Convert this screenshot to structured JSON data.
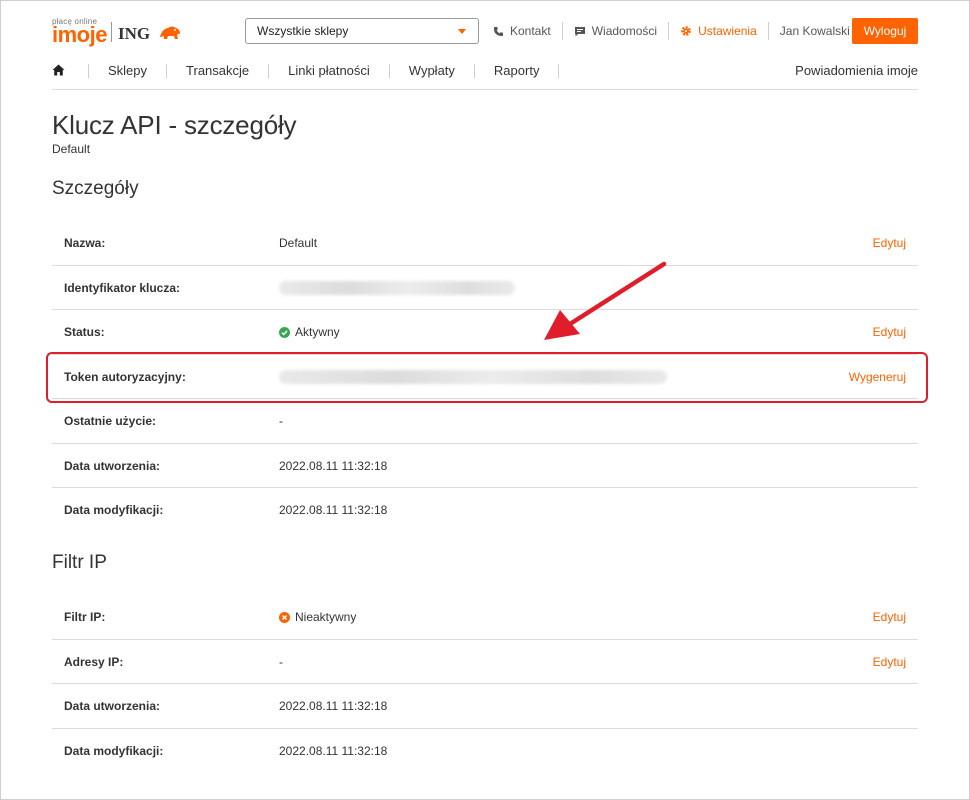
{
  "header": {
    "logo_tagline": "płacę online",
    "logo_brand": "imoje",
    "logo_bank": "ING",
    "shop_select": "Wszystkie sklepy",
    "nav": [
      {
        "label": "Kontakt",
        "icon": "phone-icon"
      },
      {
        "label": "Wiadomości",
        "icon": "message-icon"
      },
      {
        "label": "Ustawienia",
        "icon": "gear-icon"
      },
      {
        "label": "Jan Kowalski",
        "icon": ""
      }
    ],
    "logout_label": "Wyloguj"
  },
  "main_nav": {
    "items": [
      "Sklepy",
      "Transakcje",
      "Linki płatności",
      "Wypłaty",
      "Raporty"
    ],
    "notifications": "Powiadomienia imoje"
  },
  "page": {
    "title": "Klucz API - szczegóły",
    "subtitle": "Default"
  },
  "details": {
    "heading": "Szczegóły",
    "rows": [
      {
        "label": "Nazwa:",
        "value": "Default",
        "action": "Edytuj"
      },
      {
        "label": "Identyfikator klucza:",
        "value": "",
        "action": ""
      },
      {
        "label": "Status:",
        "value": "Aktywny",
        "action": "Edytuj"
      },
      {
        "label": "Token autoryzacyjny:",
        "value": "",
        "action": "Wygeneruj"
      },
      {
        "label": "Ostatnie użycie:",
        "value": "-",
        "action": ""
      },
      {
        "label": "Data utworzenia:",
        "value": "2022.08.11 11:32:18",
        "action": ""
      },
      {
        "label": "Data modyfikacji:",
        "value": "2022.08.11 11:32:18",
        "action": ""
      }
    ]
  },
  "ip_filter": {
    "heading": "Filtr IP",
    "rows": [
      {
        "label": "Filtr IP:",
        "value": "Nieaktywny",
        "action": "Edytuj"
      },
      {
        "label": "Adresy IP:",
        "value": "-",
        "action": "Edytuj"
      },
      {
        "label": "Data utworzenia:",
        "value": "2022.08.11 11:32:18",
        "action": ""
      },
      {
        "label": "Data modyfikacji:",
        "value": "2022.08.11 11:32:18",
        "action": ""
      }
    ]
  },
  "colors": {
    "accent": "#ff6200",
    "success": "#3aa655",
    "annotation": "#e01d2a"
  }
}
